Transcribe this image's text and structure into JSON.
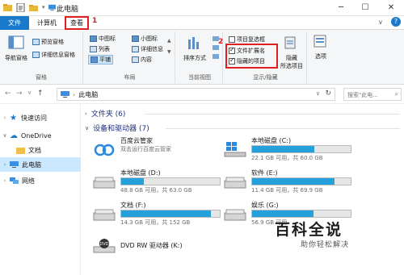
{
  "titlebar": {
    "title": "此电脑",
    "minimize": "─",
    "maximize": "☐",
    "close": "✕",
    "icons": [
      "folder-icon",
      "properties-icon",
      "new-folder-icon"
    ]
  },
  "tabs": {
    "file": "文件",
    "computer": "计算机",
    "view": "查看"
  },
  "annotations": {
    "one": "1",
    "two": "2"
  },
  "ribbon": {
    "panes": {
      "label": "窗格",
      "nav_pane": "导航窗格",
      "preview_pane": "预览窗格",
      "details_pane": "详细信息窗格"
    },
    "layout": {
      "label": "布局",
      "medium_icons": "中图标",
      "small_icons": "小图标",
      "list": "列表",
      "details": "详细信息",
      "tiles": "平铺",
      "content": "内容"
    },
    "current_view": {
      "label": "当前视图",
      "sort_by": "排序方式"
    },
    "show_hide": {
      "label": "显示/隐藏",
      "item_checkboxes": "项目复选框",
      "item_checkboxes_checked": false,
      "file_extensions": "文件扩展名",
      "file_extensions_checked": true,
      "hidden_items": "隐藏的项目",
      "hidden_items_checked": true,
      "hide_selected": "隐藏",
      "hide_selected_2": "所选项目"
    },
    "options": "选项"
  },
  "address": {
    "path": "此电脑",
    "search_placeholder": "搜索\"此电..."
  },
  "nav": {
    "quick_access": "快速访问",
    "onedrive": "OneDrive",
    "documents": "文档",
    "this_pc": "此电脑",
    "network": "网络"
  },
  "content": {
    "folders_header": "文件夹 (6)",
    "devices_header": "设备和驱动器 (7)",
    "drives": [
      {
        "name": "百度云管家",
        "free": "双击运行百度云管家",
        "fill": null
      },
      {
        "name": "本地磁盘 (C:)",
        "free": "22.1 GB 可用，共 60.0 GB",
        "fill": 0.63
      },
      {
        "name": "本地磁盘 (D:)",
        "free": "48.8 GB 可用，共 63.0 GB",
        "fill": 0.23
      },
      {
        "name": "软件 (E:)",
        "free": "11.4 GB 可用，共 69.9 GB",
        "fill": 0.84
      },
      {
        "name": "文档 (F:)",
        "free": "14.3 GB 可用，共 152 GB",
        "fill": 0.91
      },
      {
        "name": "娱乐 (G:)",
        "free": "56.9 GB 可用",
        "fill": 0.62
      },
      {
        "name": "DVD RW 驱动器 (K:)",
        "free": "",
        "fill": null
      }
    ]
  },
  "watermark": {
    "title": "百科全说",
    "subtitle": "助你轻松解决"
  },
  "colors": {
    "accent": "#1979ca",
    "drive_fill": "#26a0da",
    "highlight": "#e02020",
    "selected_nav": "#cce8ff"
  }
}
